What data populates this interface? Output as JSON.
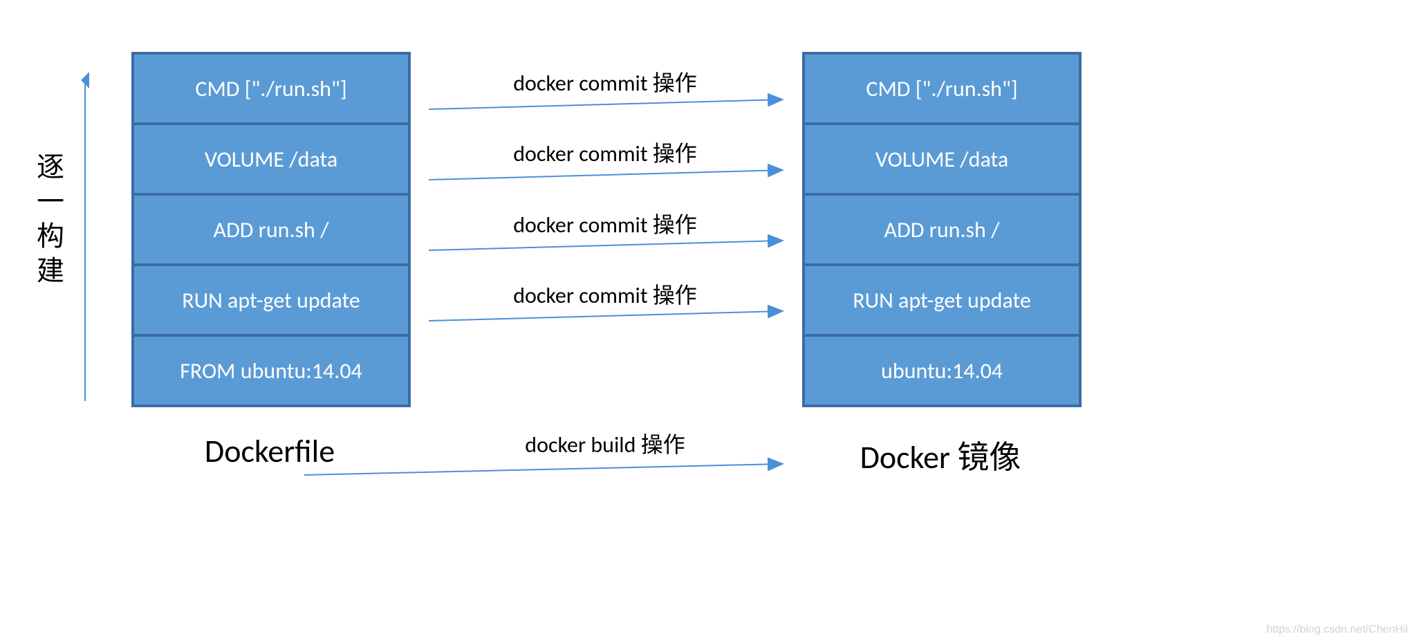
{
  "colors": {
    "box_fill": "#5b9bd5",
    "box_border": "#3a6ca5",
    "arrow": "#4a90d9"
  },
  "vertical_label": "逐一构建",
  "left": {
    "title": "Dockerfile",
    "layers": [
      "CMD [\"./run.sh\"]",
      "VOLUME /data",
      "ADD run.sh  /",
      "RUN apt-get update",
      "FROM ubuntu:14.04"
    ]
  },
  "right": {
    "title": "Docker 镜像",
    "layers": [
      "CMD [\"./run.sh\"]",
      "VOLUME /data",
      "ADD run.sh  /",
      "RUN apt-get update",
      "ubuntu:14.04"
    ]
  },
  "arrows": {
    "commit_label": "docker commit 操作",
    "build_label": "docker build 操作"
  },
  "watermark": "https://blog.csdn.net/ChenHil"
}
